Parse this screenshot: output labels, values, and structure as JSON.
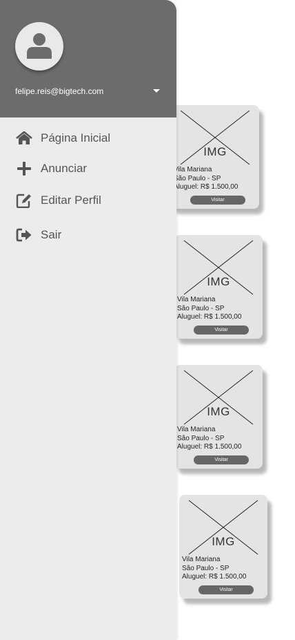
{
  "user": {
    "email": "felipe.reis@bigtech.com"
  },
  "menu": [
    {
      "label": "Página Inicial",
      "icon": "home-icon"
    },
    {
      "label": "Anunciar",
      "icon": "plus-icon"
    },
    {
      "label": "Editar Perfil",
      "icon": "edit-icon"
    },
    {
      "label": "Sair",
      "icon": "logout-icon"
    }
  ],
  "listings": [
    {
      "img_label": "IMG",
      "neighborhood": "Vila Mariana",
      "city": "São Paulo - SP",
      "rent": "Aluguel: R$ 1.500,00",
      "button": "Visitar"
    },
    {
      "img_label": "IMG",
      "neighborhood": "Vila Mariana",
      "city": "São Paulo - SP",
      "rent": "Aluguel: R$ 1.500,00",
      "button": "Visitar"
    },
    {
      "img_label": "IMG",
      "neighborhood": "Vila Mariana",
      "city": "São Paulo - SP",
      "rent": "Aluguel: R$ 1.500,00",
      "button": "Visitar"
    },
    {
      "img_label": "IMG",
      "neighborhood": "Vila Mariana",
      "city": "São Paulo - SP",
      "rent": "Aluguel: R$ 1.500,00",
      "button": "Visitar"
    }
  ],
  "colors": {
    "header": "#6c6c6c",
    "drawer": "#ececec",
    "card": "#e4e4e4",
    "button": "#666666"
  }
}
